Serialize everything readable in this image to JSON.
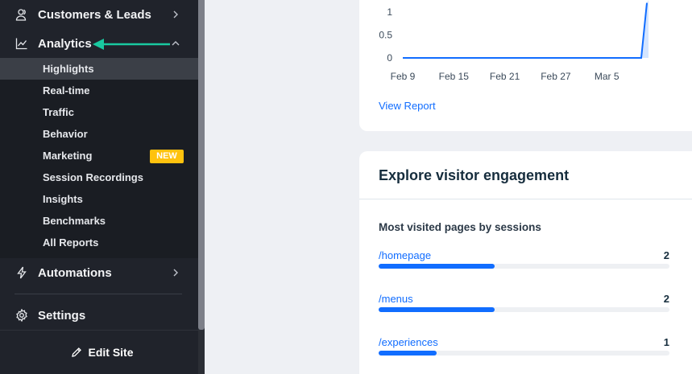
{
  "sidebar": {
    "items": [
      {
        "label": "Customers & Leads",
        "icon": "people-icon"
      },
      {
        "label": "Analytics",
        "icon": "line-chart-icon"
      },
      {
        "label": "Automations",
        "icon": "lightning-icon"
      },
      {
        "label": "Settings",
        "icon": "gear-icon"
      }
    ],
    "analytics_subitems": [
      {
        "label": "Highlights",
        "active": true
      },
      {
        "label": "Real-time"
      },
      {
        "label": "Traffic"
      },
      {
        "label": "Behavior"
      },
      {
        "label": "Marketing",
        "badge": "NEW"
      },
      {
        "label": "Session Recordings"
      },
      {
        "label": "Insights"
      },
      {
        "label": "Benchmarks"
      },
      {
        "label": "All Reports"
      }
    ],
    "edit_site_label": "Edit Site",
    "annotation_arrow_color": "#19c9a0"
  },
  "chart_card": {
    "view_report_label": "View Report",
    "chart_data": {
      "type": "area",
      "x_tick_labels": [
        "Feb 9",
        "Feb 15",
        "Feb 21",
        "Feb 27",
        "Mar 5"
      ],
      "y_tick_labels": [
        "1",
        "0.5",
        "0"
      ],
      "ylim": [
        0,
        1.2
      ],
      "series_color": "#116dff",
      "points": [
        {
          "x": "Feb 9",
          "y": 0
        },
        {
          "x": "Feb 15",
          "y": 0
        },
        {
          "x": "Feb 21",
          "y": 0
        },
        {
          "x": "Feb 27",
          "y": 0
        },
        {
          "x": "Mar 5",
          "y": 0
        },
        {
          "x": "Mar 10",
          "y": 0
        },
        {
          "x": "Mar 11",
          "y": 1.2
        }
      ]
    }
  },
  "engagement_card": {
    "title": "Explore visitor engagement",
    "section_title": "Most visited pages by sessions",
    "max_sessions": 5,
    "pages": [
      {
        "path": "/homepage",
        "sessions": 2
      },
      {
        "path": "/menus",
        "sessions": 2
      },
      {
        "path": "/experiences",
        "sessions": 1
      }
    ]
  }
}
